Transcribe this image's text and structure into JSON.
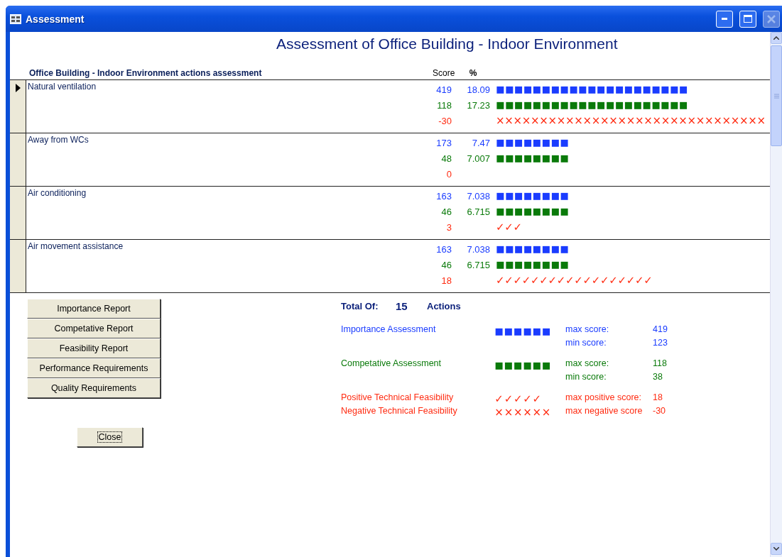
{
  "window": {
    "title": "Assessment",
    "close_disabled": true
  },
  "heading": "Assessment of Office Building - Indoor Environment",
  "list": {
    "columns": [
      "Office Building - Indoor Environment actions assessment",
      "Score",
      "%"
    ],
    "rows": [
      {
        "name": "Natural ventilation",
        "selected": true,
        "lines": [
          {
            "kind": "importance",
            "score": "419",
            "percent": "18.09",
            "bar": "■■■■■■■■■■■■■■■■■■■■■"
          },
          {
            "kind": "competitive",
            "score": "118",
            "percent": "17.23",
            "bar": "■■■■■■■■■■■■■■■■■■■■■"
          },
          {
            "kind": "feasibility",
            "score": "-30",
            "bar": "×××××××××××××××××××××××××××××××"
          }
        ]
      },
      {
        "name": "Away from WCs",
        "selected": false,
        "lines": [
          {
            "kind": "importance",
            "score": "173",
            "percent": "7.47",
            "bar": "■■■■■■■■"
          },
          {
            "kind": "competitive",
            "score": "48",
            "percent": "7.007",
            "bar": "■■■■■■■■"
          },
          {
            "kind": "feasibility",
            "score": "0"
          }
        ]
      },
      {
        "name": "Air conditioning",
        "selected": false,
        "lines": [
          {
            "kind": "importance",
            "score": "163",
            "percent": "7.038",
            "bar": "■■■■■■■■"
          },
          {
            "kind": "competitive",
            "score": "46",
            "percent": "6.715",
            "bar": "■■■■■■■■"
          },
          {
            "kind": "feasibility",
            "score": "3",
            "bar": "✓✓✓"
          }
        ]
      },
      {
        "name": "Air movement assistance",
        "selected": false,
        "lines": [
          {
            "kind": "importance",
            "score": "163",
            "percent": "7.038",
            "bar": "■■■■■■■■"
          },
          {
            "kind": "competitive",
            "score": "46",
            "percent": "6.715",
            "bar": "■■■■■■■■"
          },
          {
            "kind": "feasibility",
            "score": "18",
            "bar": "✓✓✓✓✓✓✓✓✓✓✓✓✓✓✓✓✓✓"
          }
        ]
      }
    ]
  },
  "report_buttons": [
    "Importance Report",
    "Competative Report",
    "Feasibility Report",
    "Performance Requirements",
    "Quality Requirements"
  ],
  "close_button": "Close",
  "summary": {
    "total_label": "Total Of:",
    "total": "15",
    "total_unit": "Actions",
    "items": [
      {
        "kind": "importance",
        "label": "Importance Assessment",
        "symbols": "■■■■■■",
        "stats": [
          {
            "label": "max score:",
            "value": "419"
          },
          {
            "label": "min score:",
            "value": "123"
          }
        ]
      },
      {
        "kind": "competitive",
        "label": "Competative Assessment",
        "symbols": "■■■■■■",
        "stats": [
          {
            "label": "max score:",
            "value": "118"
          },
          {
            "label": "min score:",
            "value": "38"
          }
        ]
      },
      {
        "kind": "feasibility",
        "label": "Positive Technical Feasibility",
        "symbols": "✓✓✓✓✓",
        "stats": [
          {
            "label": "max positive score:",
            "value": "18"
          }
        ]
      },
      {
        "kind": "feasibility",
        "label": "Negative Technical Feasibility",
        "symbols": "××××××",
        "stats": [
          {
            "label": "max negative score",
            "value": "-30"
          }
        ]
      }
    ]
  }
}
